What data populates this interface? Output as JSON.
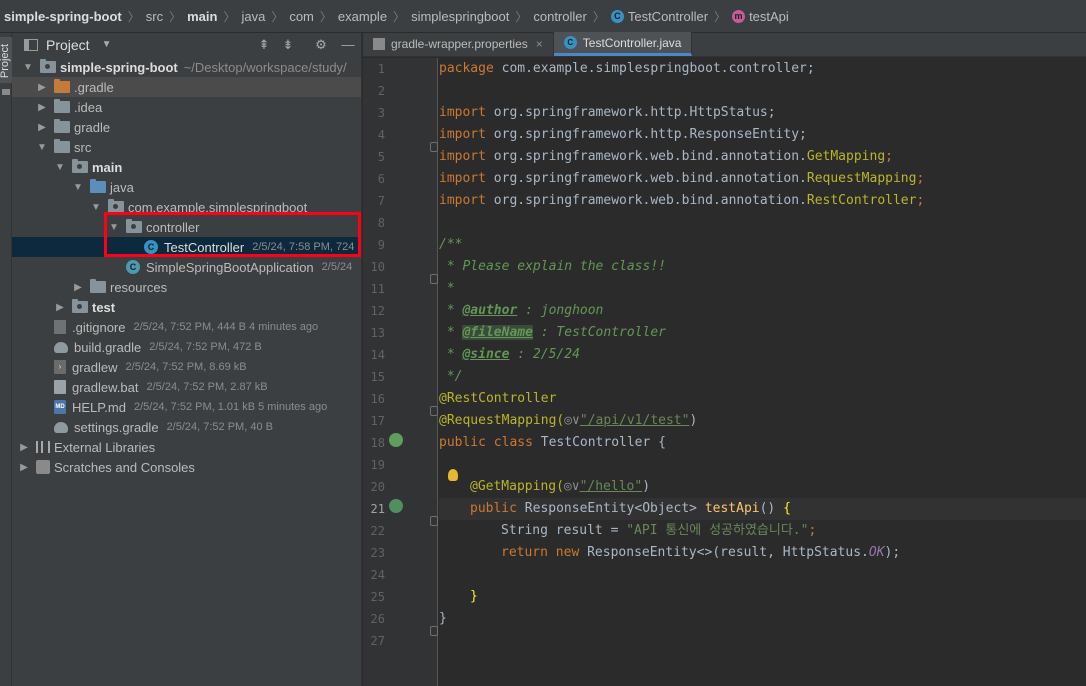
{
  "breadcrumb": [
    {
      "label": "simple-spring-boot",
      "bold": true
    },
    {
      "label": "src"
    },
    {
      "label": "main",
      "bold": true
    },
    {
      "label": "java"
    },
    {
      "label": "com"
    },
    {
      "label": "example"
    },
    {
      "label": "simplespringboot"
    },
    {
      "label": "controller"
    },
    {
      "label": "TestController",
      "icon": "class-icon"
    },
    {
      "label": "testApi",
      "icon": "method-icon"
    }
  ],
  "toolstrip": {
    "project_label": "Project"
  },
  "project_panel": {
    "title": "Project",
    "project_name": "simple-spring-boot",
    "project_path": "~/Desktop/workspace/study/",
    "items": {
      "gradle_hidden": ".gradle",
      "idea": ".idea",
      "gradle": "gradle",
      "src": "src",
      "main": "main",
      "java": "java",
      "package": "com.example.simplespringboot",
      "controller": "controller",
      "test_controller": "TestController",
      "test_controller_meta": "2/5/24, 7:58 PM, 724",
      "app": "SimpleSpringBootApplication",
      "app_meta": "2/5/24",
      "resources": "resources",
      "test": "test",
      "gitignore": ".gitignore",
      "gitignore_meta": "2/5/24, 7:52 PM, 444 B 4 minutes ago",
      "build_gradle": "build.gradle",
      "build_gradle_meta": "2/5/24, 7:52 PM, 472 B",
      "gradlew": "gradlew",
      "gradlew_meta": "2/5/24, 7:52 PM, 8.69 kB",
      "gradlew_bat": "gradlew.bat",
      "gradlew_bat_meta": "2/5/24, 7:52 PM, 2.87 kB",
      "help_md": "HELP.md",
      "help_md_meta": "2/5/24, 7:52 PM, 1.01 kB 5 minutes ago",
      "settings_gradle": "settings.gradle",
      "settings_gradle_meta": "2/5/24, 7:52 PM, 40 B",
      "external_libraries": "External Libraries",
      "scratches": "Scratches and Consoles"
    }
  },
  "editor": {
    "tabs": [
      {
        "label": "gradle-wrapper.properties",
        "active": false
      },
      {
        "label": "TestController.java",
        "active": true
      }
    ],
    "line_numbers": [
      "1",
      "2",
      "3",
      "4",
      "5",
      "6",
      "7",
      "8",
      "9",
      "10",
      "11",
      "12",
      "13",
      "14",
      "15",
      "16",
      "17",
      "18",
      "19",
      "20",
      "21",
      "22",
      "23",
      "24",
      "25",
      "26",
      "27"
    ],
    "code": {
      "package_kw": "package",
      "package_name": " com.example.simplespringboot.controller;",
      "import_kw": "import",
      "imp1": " org.springframework.http.HttpStatus;",
      "imp2": " org.springframework.http.ResponseEntity;",
      "imp3_pre": " org.springframework.web.bind.annotation.",
      "imp3_ann": "GetMapping",
      "imp4_ann": "RequestMapping",
      "imp5_ann": "RestController",
      "semi": ";",
      "doc_open": "/**",
      "doc_line1": " * Please explain the class!!",
      "doc_star": " *",
      "doc_author_tag": "@author",
      "doc_author_val": " : jonghoon",
      "doc_file_tag": "@fileName",
      "doc_file_val": " : TestController",
      "doc_since_tag": "@since",
      "doc_since_val": " : 2/5/24",
      "doc_close": " */",
      "rest_controller": "@RestController",
      "request_mapping": "@RequestMapping(",
      "globe": "◎∨",
      "api_path": "\"/api/v1/test\"",
      "close_paren": ")",
      "public_kw": "public",
      "class_kw": "class",
      "class_name": " TestController {",
      "get_mapping": "@GetMapping(",
      "hello_path": "\"/hello\"",
      "method_sig": " ResponseEntity<Object> ",
      "method_name": "testApi",
      "method_parens": "() ",
      "open_brace": "{",
      "string_type": "String result = ",
      "result_str": "\"API 통신에 성공하였습니다.\"",
      "return_kw": "return",
      "new_kw": "new",
      "return_rest": " ResponseEntity<>(result, HttpStatus.",
      "ok_const": "OK",
      "return_end": ");",
      "close_brace": "}",
      "class_close": "}"
    }
  }
}
